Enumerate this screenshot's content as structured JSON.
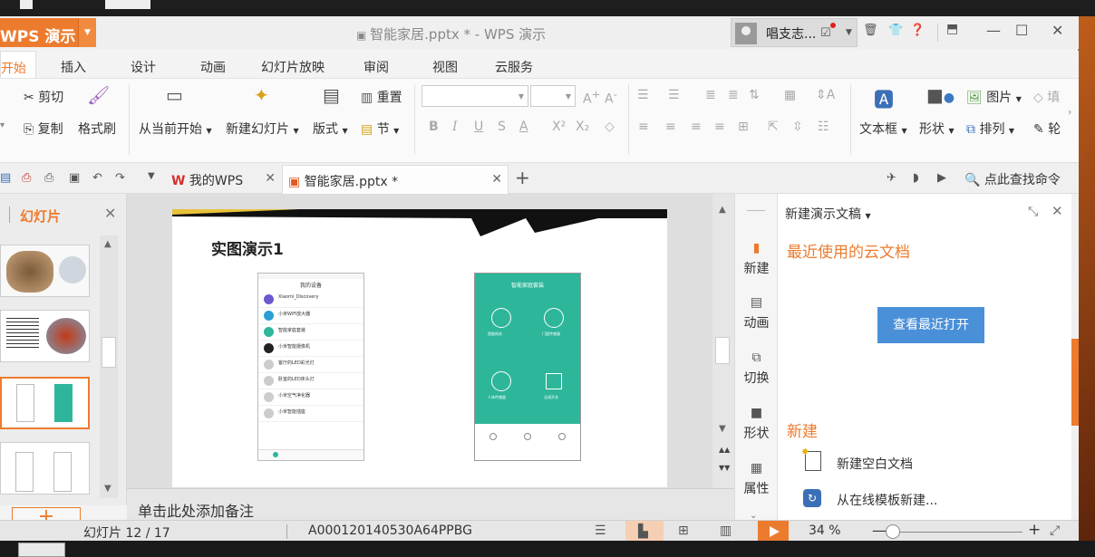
{
  "window": {
    "app_logo": "WPS 演示",
    "title": "智能家居.pptx * - WPS 演示",
    "user_name": "唱支志..."
  },
  "ribbon_tabs": [
    "开始",
    "插入",
    "设计",
    "动画",
    "幻灯片放映",
    "审阅",
    "视图",
    "云服务"
  ],
  "ribbon": {
    "cut": "剪切",
    "copy": "复制",
    "format_painter": "格式刷",
    "from_current": "从当前开始",
    "new_slide": "新建幻灯片",
    "layout": "版式",
    "reset": "重置",
    "section": "节",
    "textbox": "文本框",
    "shape": "形状",
    "picture": "图片",
    "arrange": "排列",
    "fill": "填",
    "outline": "轮"
  },
  "doc_tabs": {
    "tab1": "我的WPS",
    "tab2": "智能家居.pptx *",
    "search": "点此查找命令"
  },
  "left_panel": {
    "title": "幻灯片"
  },
  "slide": {
    "title": "实图演示1",
    "phone1_header": "我的设备",
    "phone1_items": [
      "Xiaomi_Discovery",
      "小米WiFi放大器",
      "智能家庭套装",
      "小米智能摄像机",
      "客厅的LED彩光灯",
      "卧室的LED床头灯",
      "小米空气净化器",
      "小米智能插座"
    ],
    "phone2_header": "智能家庭套装",
    "phone2_items": [
      "智能网关",
      "门窗传感器",
      "人体传感器",
      "无线开关"
    ]
  },
  "notes_placeholder": "单击此处添加备注",
  "sidebar": [
    "新建",
    "动画",
    "切换",
    "形状",
    "属性"
  ],
  "taskpane": {
    "header": "新建演示文稿",
    "recent_title": "最近使用的云文档",
    "recent_button": "查看最近打开",
    "new_title": "新建",
    "new_blank": "新建空白文档",
    "new_online": "从在线模板新建..."
  },
  "status": {
    "slide_position": "幻灯片 12 / 17",
    "doc_id": "A000120140530A64PPBG",
    "zoom": "34 %"
  },
  "colors": {
    "accent": "#ec7b2e",
    "button_blue": "#4a90d9",
    "phone_teal": "#2eb69a"
  }
}
